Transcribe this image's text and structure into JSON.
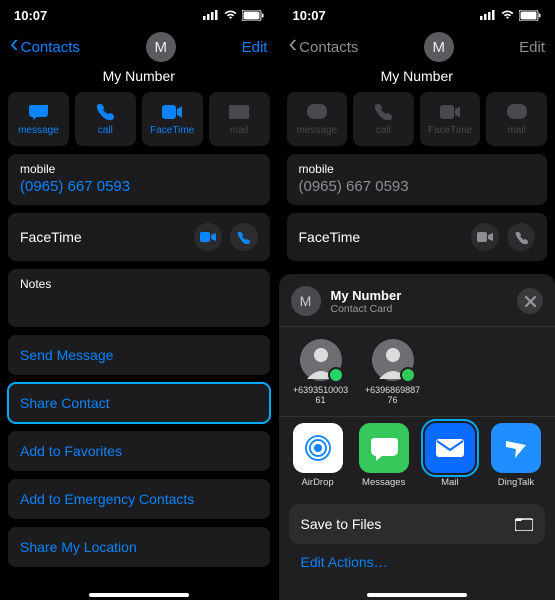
{
  "left": {
    "status": {
      "time": "10:07"
    },
    "nav": {
      "back": "Contacts",
      "edit": "Edit"
    },
    "contact": {
      "initial": "M",
      "name": "My Number"
    },
    "tiles": {
      "message": "message",
      "call": "call",
      "facetime": "FaceTime",
      "mail": "mail"
    },
    "mobile": {
      "label": "mobile",
      "value": "(0965) 667 0593"
    },
    "facetime_label": "FaceTime",
    "notes_label": "Notes",
    "links": {
      "send_message": "Send Message",
      "share_contact": "Share Contact",
      "add_fav": "Add to Favorites",
      "add_emerg": "Add to Emergency Contacts",
      "share_loc": "Share My Location"
    }
  },
  "right": {
    "status": {
      "time": "10:07"
    },
    "nav": {
      "back": "Contacts",
      "edit": "Edit"
    },
    "contact": {
      "initial": "M",
      "name": "My Number"
    },
    "tiles": {
      "message": "message",
      "call": "call",
      "facetime": "FaceTime",
      "mail": "mail"
    },
    "mobile": {
      "label": "mobile",
      "value": "(0965) 667 0593"
    },
    "facetime_label": "FaceTime",
    "sheet": {
      "title": "My Number",
      "subtitle": "Contact Card",
      "avatar_initial": "M",
      "recents": [
        {
          "number": "+639351000361"
        },
        {
          "number": "+639686988776"
        }
      ],
      "apps": {
        "airdrop": "AirDrop",
        "messages": "Messages",
        "mail": "Mail",
        "dingtalk": "DingTalk"
      },
      "save_files": "Save to Files",
      "edit_actions": "Edit Actions…"
    }
  }
}
